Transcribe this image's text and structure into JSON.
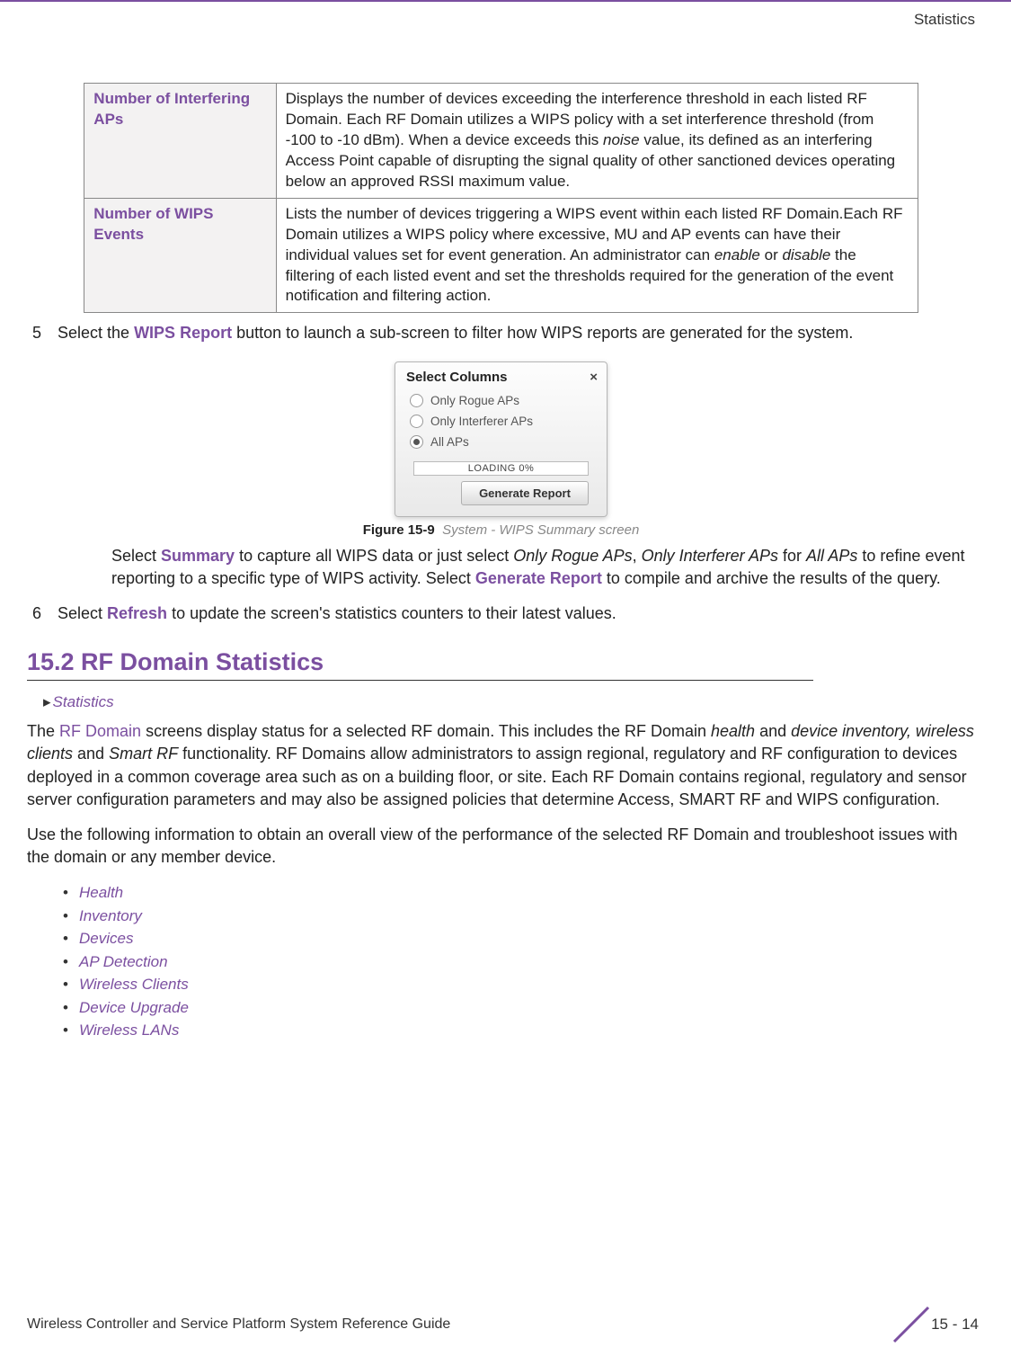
{
  "header": {
    "section": "Statistics"
  },
  "table": {
    "rows": [
      {
        "label": "Number of Interfering APs",
        "desc_pre": "Displays the number of devices exceeding the interference threshold in each listed RF Domain. Each RF Domain utilizes a WIPS policy with a set interference threshold (from -100 to -10 dBm). When a device exceeds this ",
        "desc_ital1": "noise",
        "desc_post": " value, its defined as an interfering Access Point capable of disrupting the signal quality of other sanctioned devices operating below an approved RSSI maximum value."
      },
      {
        "label": "Number of WIPS Events",
        "desc_pre": "Lists the number of devices triggering a WIPS event within each listed RF Domain.Each RF Domain utilizes a WIPS policy where excessive, MU and AP events can have their individual values set for event generation. An administrator can ",
        "desc_ital1": "enable",
        "desc_mid": " or ",
        "desc_ital2": "disable",
        "desc_post": " the filtering of each listed event and set the thresholds required for the generation of the event notification and filtering action."
      }
    ]
  },
  "step5": {
    "num": "5",
    "pre": "Select the ",
    "bold": "WIPS Report",
    "post": " button to launch a sub-screen to filter how WIPS reports are generated for the system."
  },
  "dialog": {
    "title": "Select Columns",
    "close": "×",
    "opt1": "Only Rogue APs",
    "opt2": "Only Interferer APs",
    "opt3": "All APs",
    "loading": "LOADING 0%",
    "button": "Generate Report"
  },
  "figure": {
    "label": "Figure 15-9",
    "desc": "System - WIPS Summary screen"
  },
  "summaryPara": {
    "pre": "Select ",
    "b1": "Summary",
    "t1": " to capture all WIPS data or just select ",
    "i1": "Only Rogue APs",
    "t2": ", ",
    "i2": "Only Interferer APs",
    "t3": " for ",
    "i3": "All APs",
    "t4": " to refine event reporting to a specific type of WIPS activity. Select ",
    "b2": "Generate Report",
    "t5": " to compile and archive the results of the query."
  },
  "step6": {
    "num": "6",
    "pre": "Select ",
    "bold": "Refresh",
    "post": " to update the screen's statistics counters to their latest values."
  },
  "sectionHeading": "15.2 RF Domain Statistics",
  "breadcrumb": "Statistics",
  "para1": {
    "t0": "The ",
    "link": "RF Domain",
    "t1": " screens display status for a selected RF domain. This includes the RF Domain ",
    "i1": "health",
    "t2": " and ",
    "i2": "device inventory, wireless clients",
    "t3": " and ",
    "i3": "Smart RF",
    "t4": " functionality. RF Domains allow administrators to assign regional, regulatory and RF configuration to devices deployed in a common coverage area such as on a building floor, or site. Each RF Domain contains regional, regulatory and sensor server configuration parameters and may also be assigned policies that determine Access, SMART RF and WIPS configuration."
  },
  "para2": "Use the following information to obtain an overall view of the performance of the selected RF Domain and troubleshoot issues with the domain or any member device.",
  "links": [
    "Health",
    "Inventory",
    "Devices",
    "AP Detection",
    "Wireless Clients",
    "Device Upgrade",
    "Wireless LANs"
  ],
  "footer": {
    "left": "Wireless Controller and Service Platform System Reference Guide",
    "page": "15 - 14"
  }
}
